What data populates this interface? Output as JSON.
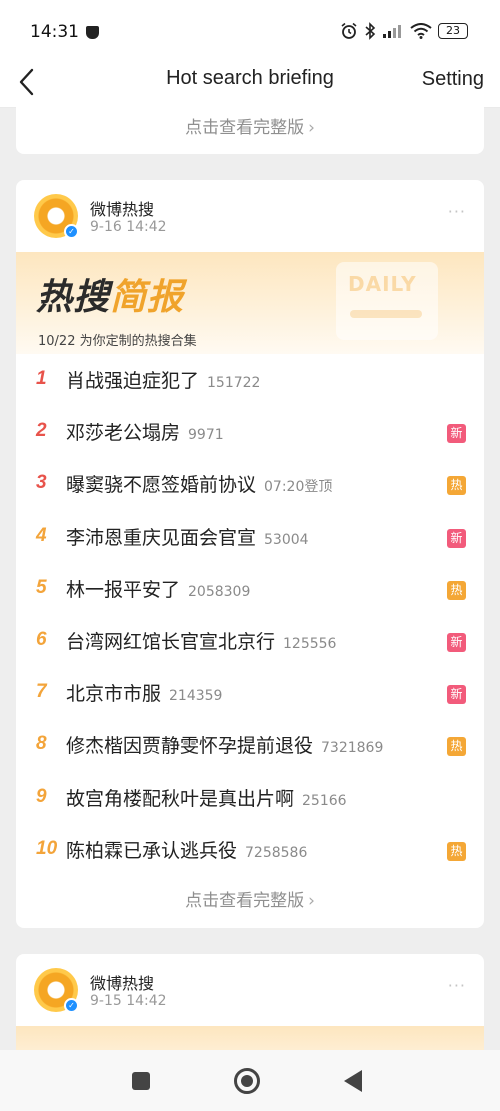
{
  "status_bar": {
    "time": "14:31",
    "battery": "23",
    "icons": [
      "shield-icon",
      "alarm-icon",
      "bluetooth-icon",
      "signal-icon",
      "wifi-icon",
      "battery-icon"
    ]
  },
  "header": {
    "title": "Hot search briefing",
    "setting_label": "Setting"
  },
  "top_card": {
    "view_full_label": "点击查看完整版"
  },
  "main_card": {
    "source_name": "微博热搜",
    "timestamp": "9-16 14:42",
    "banner_title_part1": "热搜",
    "banner_title_part2": "简报",
    "banner_decoration": "DAILY",
    "banner_subtitle": "10/22 为你定制的热搜合集",
    "items": [
      {
        "rank": "1",
        "title": "肖战强迫症犯了",
        "count": "151722",
        "badge": ""
      },
      {
        "rank": "2",
        "title": "邓莎老公塌房",
        "count": "9971",
        "badge": "新"
      },
      {
        "rank": "3",
        "title": "曝窦骁不愿签婚前协议",
        "count": "07:20登顶",
        "badge": "热"
      },
      {
        "rank": "4",
        "title": "李沛恩重庆见面会官宣",
        "count": "53004",
        "badge": "新"
      },
      {
        "rank": "5",
        "title": "林一报平安了",
        "count": "2058309",
        "badge": "热"
      },
      {
        "rank": "6",
        "title": "台湾网红馆长官宣北京行",
        "count": "125556",
        "badge": "新"
      },
      {
        "rank": "7",
        "title": "北京市市服",
        "count": "214359",
        "badge": "新"
      },
      {
        "rank": "8",
        "title": "修杰楷因贾静雯怀孕提前退役",
        "count": "7321869",
        "badge": "热"
      },
      {
        "rank": "9",
        "title": "故宫角楼配秋叶是真出片啊",
        "count": "25166",
        "badge": ""
      },
      {
        "rank": "10",
        "title": "陈柏霖已承认逃兵役",
        "count": "7258586",
        "badge": "热"
      }
    ],
    "view_full_label": "点击查看完整版"
  },
  "next_card": {
    "source_name": "微博热搜",
    "timestamp": "9-15 14:42"
  },
  "colors": {
    "rank_top": "#e8534b",
    "rank_other": "#f3a43a",
    "badge_new": "#f25b7b",
    "badge_hot": "#f4a736",
    "banner_accent": "#f0a32b"
  }
}
